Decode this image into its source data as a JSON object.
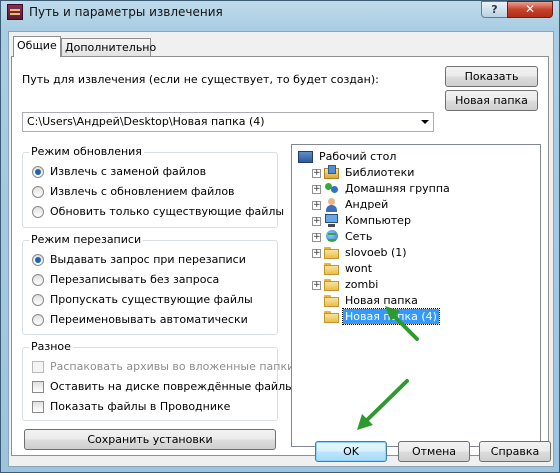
{
  "window": {
    "title": "Путь и параметры извлечения"
  },
  "tabs": [
    {
      "label": "Общие"
    },
    {
      "label": "Дополнительно"
    }
  ],
  "path": {
    "label": "Путь для извлечения (если не существует, то будет создан):",
    "value": "C:\\Users\\Андрей\\Desktop\\Новая папка (4)"
  },
  "buttons": {
    "show": "Показать",
    "new_folder": "Новая папка",
    "save_settings": "Сохранить установки",
    "ok": "OK",
    "cancel": "Отмена",
    "help": "Справка"
  },
  "update_mode": {
    "title": "Режим обновления",
    "options": [
      {
        "label": "Извлечь с заменой файлов",
        "checked": true
      },
      {
        "label": "Извлечь с обновлением файлов",
        "checked": false
      },
      {
        "label": "Обновить только существующие файлы",
        "checked": false
      }
    ]
  },
  "overwrite_mode": {
    "title": "Режим перезаписи",
    "options": [
      {
        "label": "Выдавать запрос при перезаписи",
        "checked": true
      },
      {
        "label": "Перезаписывать без запроса",
        "checked": false
      },
      {
        "label": "Пропускать существующие файлы",
        "checked": false
      },
      {
        "label": "Переименовывать автоматически",
        "checked": false
      }
    ]
  },
  "misc": {
    "title": "Разное",
    "options": [
      {
        "label": "Распаковать архивы во вложенные папки",
        "checked": false,
        "disabled": true
      },
      {
        "label": "Оставить на диске повреждённые файлы",
        "checked": false,
        "disabled": false
      },
      {
        "label": "Показать файлы в Проводнике",
        "checked": false,
        "disabled": false
      }
    ]
  },
  "tree": {
    "items": [
      {
        "label": "Рабочий стол",
        "icon": "desktop-icon",
        "level": 0,
        "expander": ""
      },
      {
        "label": "Библиотеки",
        "icon": "library-icon",
        "level": 1,
        "expander": "+"
      },
      {
        "label": "Домашняя группа",
        "icon": "homegroup-icon",
        "level": 1,
        "expander": "+"
      },
      {
        "label": "Андрей",
        "icon": "user-icon",
        "level": 1,
        "expander": "+"
      },
      {
        "label": "Компьютер",
        "icon": "computer-icon",
        "level": 1,
        "expander": "+"
      },
      {
        "label": "Сеть",
        "icon": "network-icon",
        "level": 1,
        "expander": "+"
      },
      {
        "label": "slovoeb (1)",
        "icon": "folder-icon",
        "level": 1,
        "expander": "+"
      },
      {
        "label": "wont",
        "icon": "folder-icon",
        "level": 1,
        "expander": ""
      },
      {
        "label": "zombi",
        "icon": "folder-icon",
        "level": 1,
        "expander": "+"
      },
      {
        "label": "Новая папка",
        "icon": "folder-icon",
        "level": 1,
        "expander": ""
      },
      {
        "label": "Новая папка (4)",
        "icon": "folder-icon",
        "level": 1,
        "expander": "",
        "selected": true
      }
    ]
  },
  "colors": {
    "annotation_arrow": "#2e9a2e",
    "selection": "#3399ff"
  }
}
